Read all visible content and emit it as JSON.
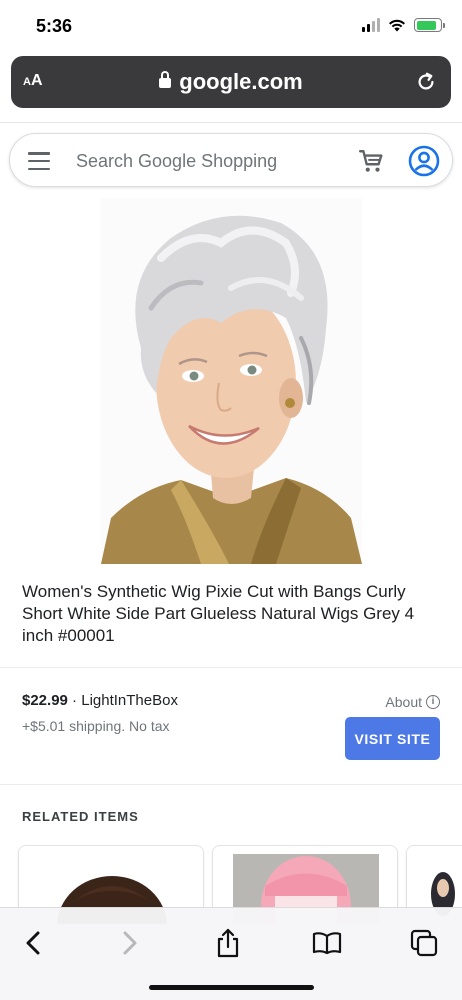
{
  "status_bar": {
    "time": "5:36",
    "battery_level": 0.85,
    "signal_bars_on": 2,
    "signal_bars_total": 4
  },
  "browser": {
    "text_size_label_large": "A",
    "text_size_label_small": "A",
    "url": "google.com",
    "icons": [
      "lock-icon",
      "reload-icon"
    ]
  },
  "search": {
    "placeholder": "Search Google Shopping",
    "icons": [
      "menu-icon",
      "cart-icon",
      "account-icon"
    ],
    "accent_color": "#1a73e8"
  },
  "product": {
    "title": "Women's Synthetic Wig Pixie Cut with Bangs Curly Short White Side Part Glueless Natural Wigs Grey 4 inch #00001",
    "price": "$22.99",
    "separator": " · ",
    "seller": "LightInTheBox",
    "shipping": "+$5.01 shipping. No tax",
    "about_label": "About",
    "visit_label": "VISIT SITE",
    "visit_color": "#4d79e6"
  },
  "related": {
    "heading": "RELATED ITEMS",
    "items": [
      {
        "thumb": "brown-bangs-wig"
      },
      {
        "thumb": "pink-bob-wig"
      },
      {
        "thumb": "dark-wig"
      }
    ]
  },
  "toolbar": {
    "buttons": [
      "back-icon",
      "forward-icon",
      "share-icon",
      "bookmarks-icon",
      "tabs-icon"
    ]
  }
}
